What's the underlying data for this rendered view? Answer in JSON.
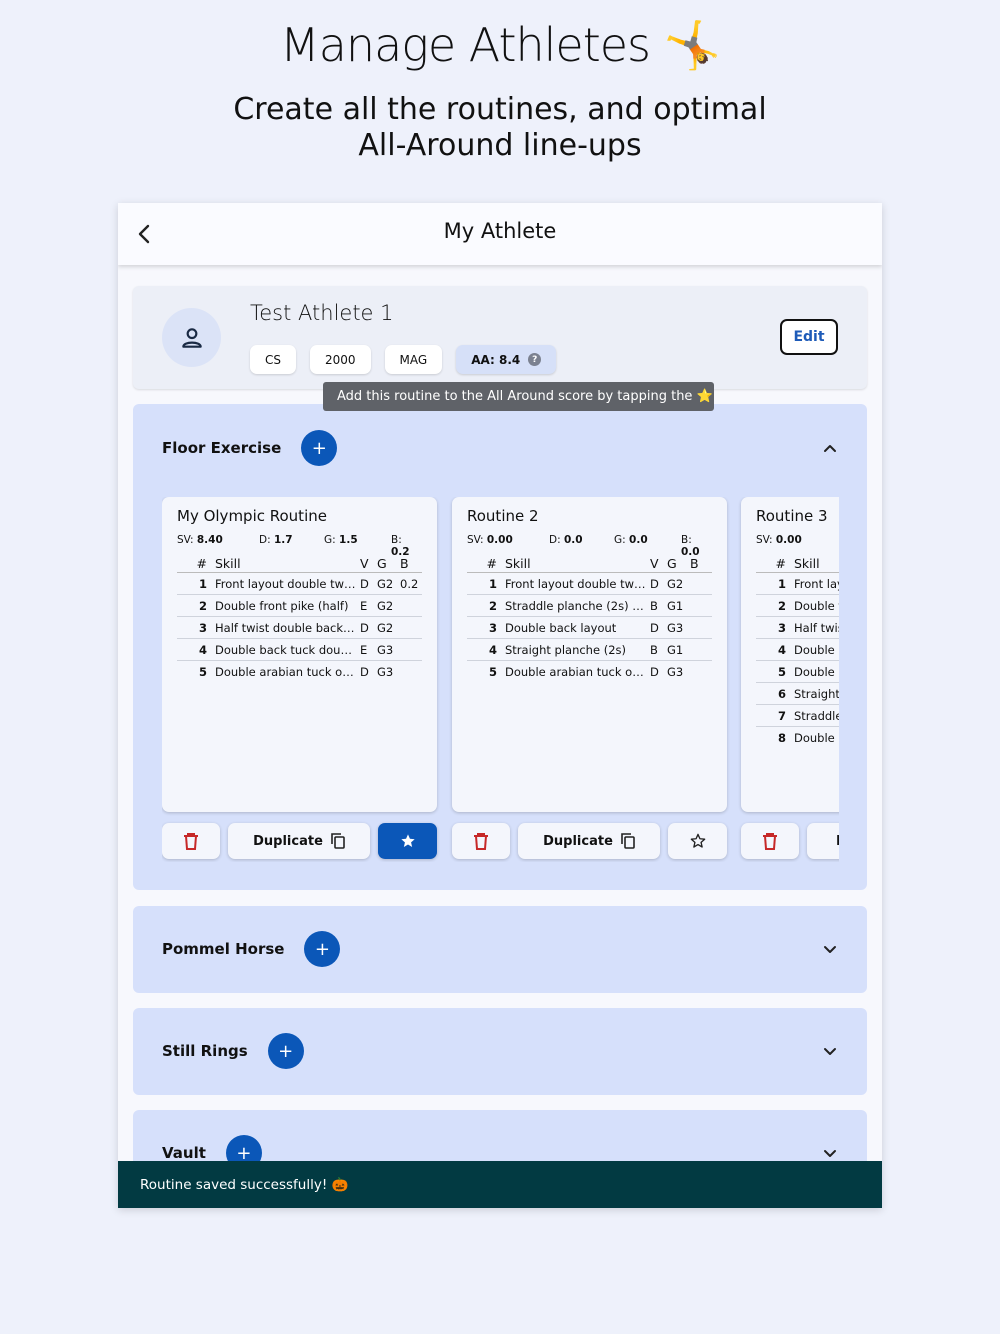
{
  "hero": {
    "title": "Manage Athletes 🤸",
    "subtitle_line1": "Create all the routines, and optimal",
    "subtitle_line2": "All-Around line-ups"
  },
  "appbar": {
    "title": "My Athlete",
    "back_icon": "chevron-left-icon"
  },
  "athlete": {
    "name": "Test Athlete 1",
    "chips": [
      "CS",
      "2000",
      "MAG"
    ],
    "aa_label": "AA: 8.4",
    "help_glyph": "?",
    "edit_label": "Edit"
  },
  "tooltip": "Add this routine to the All Around score by tapping the ⭐",
  "floor": {
    "title": "Floor Exercise",
    "add_glyph": "+",
    "header": {
      "num": "#",
      "skill": "Skill",
      "v": "V",
      "g": "G",
      "b": "B"
    },
    "routines": [
      {
        "title": "My Olympic Routine",
        "sv_label": "SV:",
        "sv": "8.40",
        "d_label": "D:",
        "d": "1.7",
        "g_label": "G:",
        "g": "1.5",
        "b_label": "B:",
        "b": "0.2",
        "skills": [
          {
            "num": "1",
            "name": "Front layout double twist",
            "v": "D",
            "g": "G2",
            "b": "0.2"
          },
          {
            "num": "2",
            "name": "Double front pike (half)",
            "v": "E",
            "g": "G2",
            "b": ""
          },
          {
            "num": "3",
            "name": "Half twist double back …",
            "v": "D",
            "g": "G2",
            "b": ""
          },
          {
            "num": "4",
            "name": "Double back tuck doub…",
            "v": "E",
            "g": "G3",
            "b": ""
          },
          {
            "num": "5",
            "name": "Double arabian tuck or…",
            "v": "D",
            "g": "G3",
            "b": ""
          }
        ],
        "starred": true
      },
      {
        "title": "Routine 2",
        "sv_label": "SV:",
        "sv": "0.00",
        "d_label": "D:",
        "d": "0.0",
        "g_label": "G:",
        "g": "0.0",
        "b_label": "B:",
        "b": "0.0",
        "skills": [
          {
            "num": "1",
            "name": "Front layout double twist",
            "v": "D",
            "g": "G2",
            "b": ""
          },
          {
            "num": "2",
            "name": "Straddle planche (2s) …",
            "v": "B",
            "g": "G1",
            "b": ""
          },
          {
            "num": "3",
            "name": "Double back layout",
            "v": "D",
            "g": "G3",
            "b": ""
          },
          {
            "num": "4",
            "name": "Straight planche (2s)",
            "v": "B",
            "g": "G1",
            "b": ""
          },
          {
            "num": "5",
            "name": "Double arabian tuck or…",
            "v": "D",
            "g": "G3",
            "b": ""
          }
        ],
        "starred": false
      },
      {
        "title": "Routine 3",
        "sv_label": "SV:",
        "sv": "0.00",
        "d_label": "D",
        "d": "",
        "skills": [
          {
            "num": "1",
            "name": "Front lay"
          },
          {
            "num": "2",
            "name": "Double f"
          },
          {
            "num": "3",
            "name": "Half twis"
          },
          {
            "num": "4",
            "name": "Double b"
          },
          {
            "num": "5",
            "name": "Double b"
          },
          {
            "num": "6",
            "name": "Straight"
          },
          {
            "num": "7",
            "name": "Straddle"
          },
          {
            "num": "8",
            "name": "Double a"
          }
        ]
      }
    ],
    "duplicate_label": "Duplicate",
    "partial_dup_label": "D"
  },
  "apparatus": [
    {
      "title": "Pommel Horse",
      "add_glyph": "+"
    },
    {
      "title": "Still Rings",
      "add_glyph": "+"
    },
    {
      "title": "Vault",
      "add_glyph": "+"
    }
  ],
  "snackbar": "Routine saved successfully! 🎃",
  "colors": {
    "primary": "#0b57b8",
    "panel": "#d6e0fb",
    "delete": "#c62828",
    "snackbar": "#023a42"
  }
}
